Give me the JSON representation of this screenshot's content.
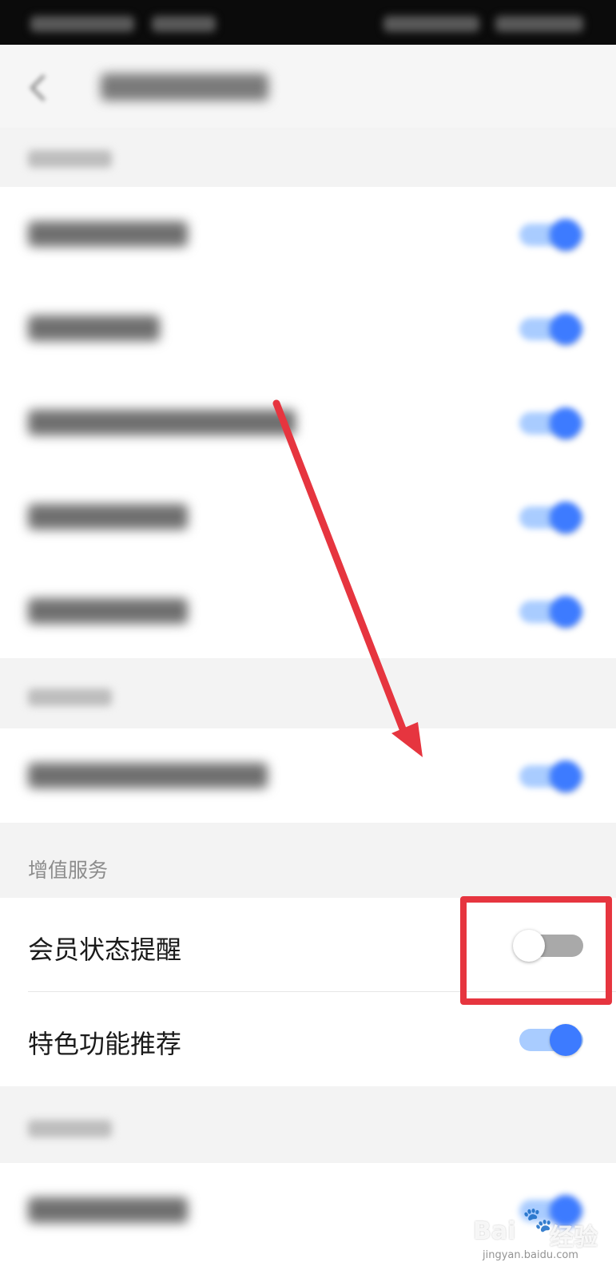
{
  "colors": {
    "accent": "#3d7bff",
    "toggle_on_track": "#a9ccff",
    "toggle_off_track": "#a9a9a9",
    "annotation_red": "#e6353f"
  },
  "sections": {
    "value_added": {
      "title": "增值服务",
      "items": [
        {
          "label": "会员状态提醒",
          "toggle_on": false
        },
        {
          "label": "特色功能推荐",
          "toggle_on": true
        }
      ]
    }
  },
  "blurred_toggles": [
    true,
    true,
    true,
    true,
    true,
    true,
    true
  ],
  "watermark": {
    "brand": "Bai",
    "brand2": "经验",
    "domain": "jingyan.baidu.com"
  }
}
